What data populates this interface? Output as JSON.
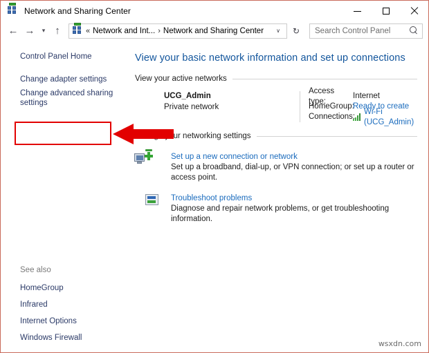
{
  "window": {
    "title": "Network and Sharing Center",
    "title_icon": "network-icon",
    "controls": {
      "minimize": "Minimize",
      "maximize": "Maximize",
      "close": "Close"
    }
  },
  "addressbar": {
    "back": "Back",
    "forward": "Forward",
    "recent": "Recent locations",
    "up": "Up",
    "crumb_icon": "network-icon",
    "crumb_sep_1": "«",
    "crumb_1": "Network and Int...",
    "crumb_sep_2": "›",
    "crumb_2": "Network and Sharing Center",
    "dropdown": "∨",
    "refresh": "↻",
    "search_placeholder": "Search Control Panel"
  },
  "sidebar": {
    "links": [
      {
        "label": "Control Panel Home",
        "name": "sidebar-item-control-panel-home"
      },
      {
        "label": "Change adapter settings",
        "name": "sidebar-item-change-adapter-settings"
      },
      {
        "label": "Change advanced sharing settings",
        "name": "sidebar-item-change-advanced-sharing-settings"
      }
    ],
    "see_also_title": "See also",
    "see_also": [
      {
        "label": "HomeGroup",
        "name": "see-also-homegroup"
      },
      {
        "label": "Infrared",
        "name": "see-also-infrared"
      },
      {
        "label": "Internet Options",
        "name": "see-also-internet-options"
      },
      {
        "label": "Windows Firewall",
        "name": "see-also-windows-firewall"
      }
    ]
  },
  "content": {
    "heading": "View your basic network information and set up connections",
    "active_networks_title": "View your active networks",
    "active_network": {
      "name": "UCG_Admin",
      "type": "Private network",
      "details": [
        {
          "key": "Access type:",
          "value": "Internet",
          "is_link": false,
          "icon": ""
        },
        {
          "key": "HomeGroup:",
          "value": "Ready to create",
          "is_link": true,
          "icon": ""
        },
        {
          "key": "Connections:",
          "value": "Wi-Fi (UCG_Admin)",
          "is_link": true,
          "icon": "wifi-signal-icon"
        }
      ]
    },
    "change_settings_title": "Change your networking settings",
    "tasks": [
      {
        "icon": "new-connection-icon",
        "link": "Set up a new connection or network",
        "desc": "Set up a broadband, dial-up, or VPN connection; or set up a router or access point."
      },
      {
        "icon": "troubleshoot-icon",
        "link": "Troubleshoot problems",
        "desc": "Diagnose and repair network problems, or get troubleshooting information."
      }
    ]
  },
  "annotations": {
    "highlight_color": "#e20000",
    "highlight_target": "Change advanced sharing settings",
    "arrow_direction": "left"
  },
  "watermark": "wsxdn.com"
}
